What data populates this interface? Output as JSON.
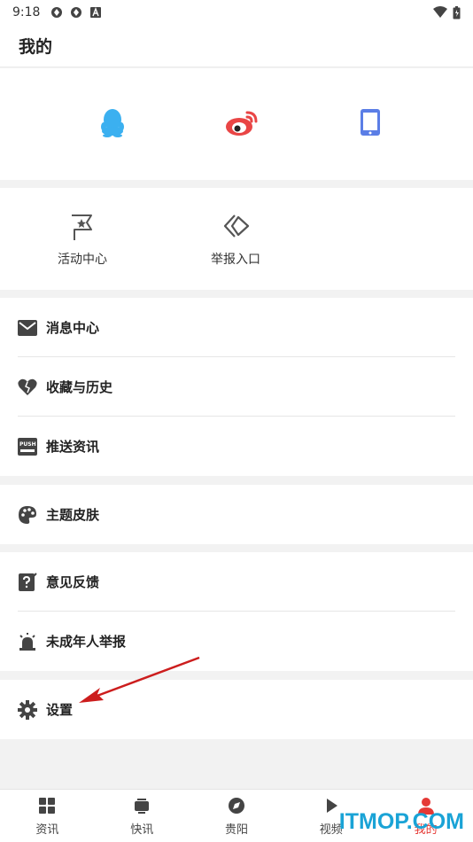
{
  "status_bar": {
    "time": "9:18"
  },
  "header": {
    "title": "我的"
  },
  "login": {
    "icons": [
      "qq-icon",
      "weibo-icon",
      "phone-icon"
    ]
  },
  "grid": {
    "items": [
      {
        "label": "活动中心",
        "icon": "flag-star-icon"
      },
      {
        "label": "举报入口",
        "icon": "report-icon"
      }
    ]
  },
  "menu": {
    "message_center": "消息中心",
    "favorites_history": "收藏与历史",
    "push_news": "推送资讯",
    "theme_skin": "主题皮肤",
    "feedback": "意见反馈",
    "minor_report": "未成年人举报",
    "settings": "设置",
    "push_badge": "PUSH"
  },
  "tabs": [
    {
      "label": "资讯",
      "icon": "grid-icon"
    },
    {
      "label": "快讯",
      "icon": "tv-icon"
    },
    {
      "label": "贵阳",
      "icon": "compass-icon"
    },
    {
      "label": "视频",
      "icon": "play-icon"
    },
    {
      "label": "我的",
      "icon": "user-icon",
      "active": true
    }
  ],
  "watermark": "ITMOP.COM",
  "colors": {
    "accent": "#e53935",
    "qq": "#3bb0f0",
    "weibo": "#e94545",
    "phone": "#5b7ee6",
    "watermark": "#1aa3d6"
  }
}
